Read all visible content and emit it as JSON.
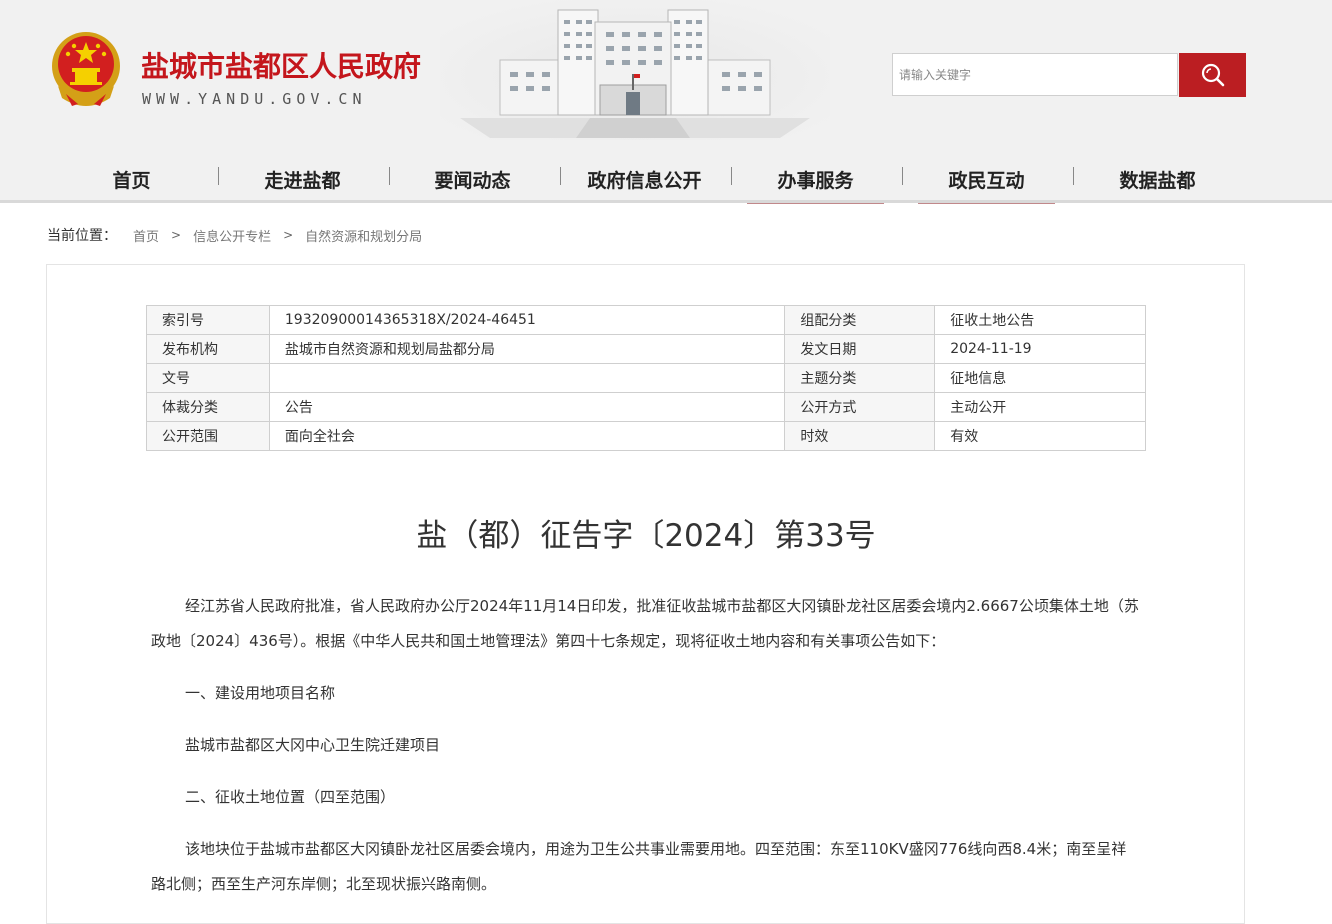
{
  "header": {
    "site_title": "盐城市盐都区人民政府",
    "site_domain": "WWW.YANDU.GOV.CN",
    "search_placeholder": "请输入关键字"
  },
  "nav": {
    "items": [
      {
        "label": "首页"
      },
      {
        "label": "走进盐都"
      },
      {
        "label": "要闻动态"
      },
      {
        "label": "政府信息公开"
      },
      {
        "label": "办事服务"
      },
      {
        "label": "政民互动"
      },
      {
        "label": "数据盐都"
      }
    ]
  },
  "breadcrumb": {
    "label": "当前位置：",
    "items": [
      "首页",
      "信息公开专栏",
      "自然资源和规划分局"
    ],
    "separator": ">"
  },
  "meta": {
    "rows": [
      [
        "索引号",
        "19320900014365318X/2024-46451",
        "组配分类",
        "征收土地公告"
      ],
      [
        "发布机构",
        "盐城市自然资源和规划局盐都分局",
        "发文日期",
        "2024-11-19"
      ],
      [
        "文号",
        "",
        "主题分类",
        "征地信息"
      ],
      [
        "体裁分类",
        "公告",
        "公开方式",
        "主动公开"
      ],
      [
        "公开范围",
        "面向全社会",
        "时效",
        "有效"
      ]
    ]
  },
  "document": {
    "title": "盐（都）征告字〔2024〕第33号",
    "paragraphs": [
      "经江苏省人民政府批准，省人民政府办公厅2024年11月14日印发，批准征收盐城市盐都区大冈镇卧龙社区居委会境内2.6667公顷集体土地（苏政地〔2024〕436号）。根据《中华人民共和国土地管理法》第四十七条规定，现将征收土地内容和有关事项公告如下：",
      "一、建设用地项目名称",
      "盐城市盐都区大冈中心卫生院迁建项目",
      "二、征收土地位置（四至范围）",
      "该地块位于盐城市盐都区大冈镇卧龙社区居委会境内，用途为卫生公共事业需要用地。四至范围：东至110KV盛冈776线向西8.4米；南至呈祥路北侧；西至生产河东岸侧；北至现状振兴路南侧。"
    ]
  },
  "colors": {
    "brand_red": "#c4161c",
    "search_button": "#bb1e22",
    "nav_active_underline": "#c1888b"
  }
}
